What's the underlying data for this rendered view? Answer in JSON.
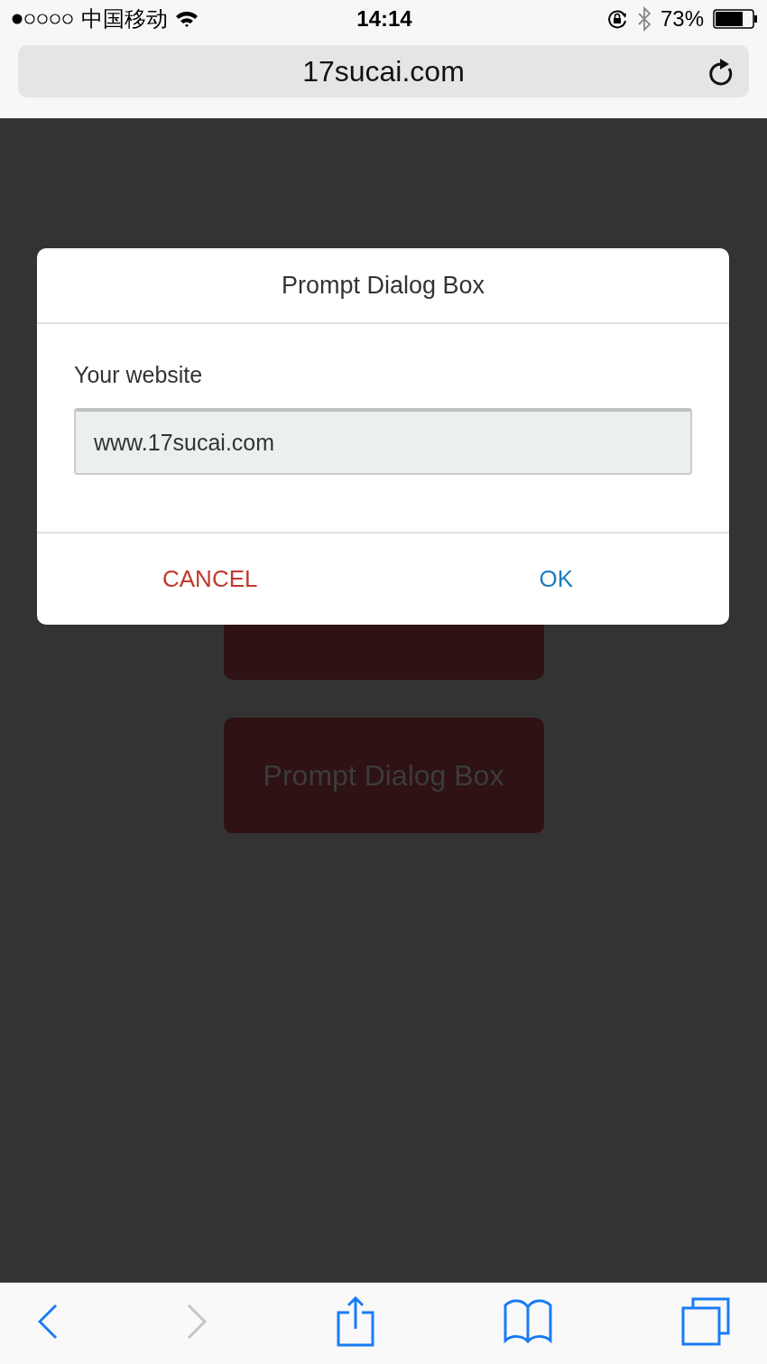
{
  "status_bar": {
    "carrier": "中国移动",
    "time": "14:14",
    "battery_percent": "73%"
  },
  "address_bar": {
    "url": "17sucai.com"
  },
  "page": {
    "button": "Prompt Dialog Box"
  },
  "dialog": {
    "title": "Prompt Dialog Box",
    "label": "Your website",
    "input_value": "www.17sucai.com",
    "buttons": [
      {
        "label": "CANCEL",
        "kind": "cancel"
      },
      {
        "label": "OK",
        "kind": "confirm"
      }
    ]
  },
  "toolbar": [
    {
      "kind": "back",
      "disabled": false
    },
    {
      "kind": "forward",
      "disabled": true
    },
    {
      "kind": "share",
      "disabled": false
    },
    {
      "kind": "bookmarks",
      "disabled": false
    },
    {
      "kind": "tabs",
      "disabled": false
    }
  ]
}
